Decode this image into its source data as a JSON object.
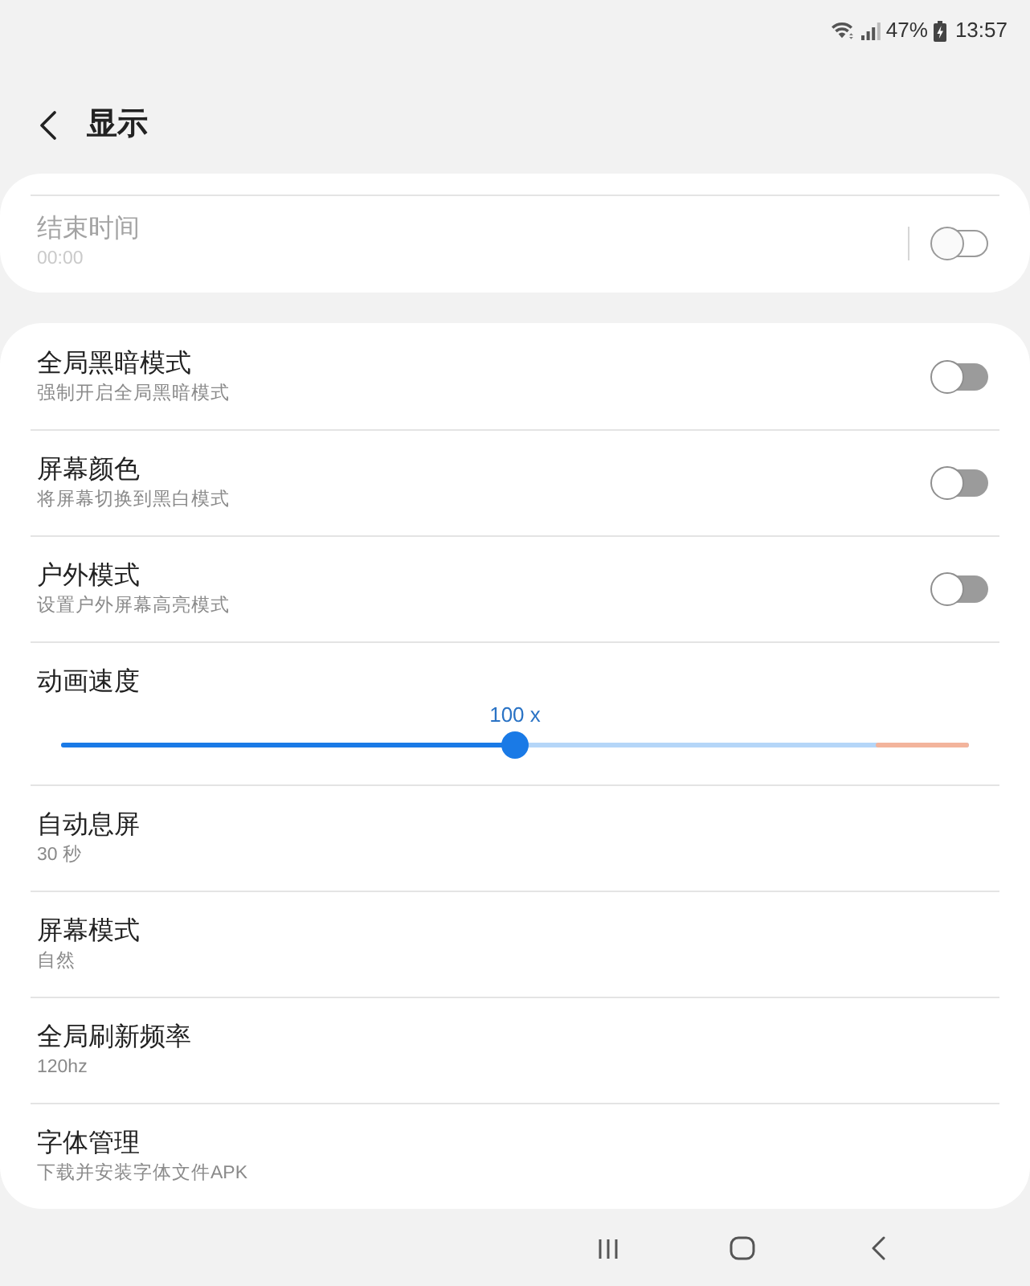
{
  "status_bar": {
    "battery": "47%",
    "time": "13:57"
  },
  "header": {
    "title": "显示"
  },
  "top_group": [
    {
      "kind": "split_toggle",
      "title": "结束时间",
      "subtitle": "00:00",
      "on": false,
      "disabled": true
    }
  ],
  "settings": [
    {
      "kind": "toggle",
      "title": "全局黑暗模式",
      "subtitle": "强制开启全局黑暗模式",
      "on": false,
      "disabled": false
    },
    {
      "kind": "toggle",
      "title": "屏幕颜色",
      "subtitle": "将屏幕切换到黑白模式",
      "on": false,
      "disabled": false
    },
    {
      "kind": "toggle",
      "title": "户外模式",
      "subtitle": "设置户外屏幕高亮模式",
      "on": false,
      "disabled": false
    },
    {
      "kind": "slider",
      "title": "动画速度",
      "value_label": "100 x",
      "level": 0.5,
      "disabled": false
    },
    {
      "kind": "info",
      "title": "自动息屏",
      "subtitle": "30 秒",
      "disabled": false
    },
    {
      "kind": "info",
      "title": "屏幕模式",
      "subtitle": "自然",
      "disabled": false
    },
    {
      "kind": "info",
      "title": "全局刷新频率",
      "subtitle": "120hz",
      "disabled": false
    },
    {
      "kind": "info",
      "title": "字体管理",
      "subtitle": "下载并安装字体文件APK",
      "disabled": false
    }
  ]
}
